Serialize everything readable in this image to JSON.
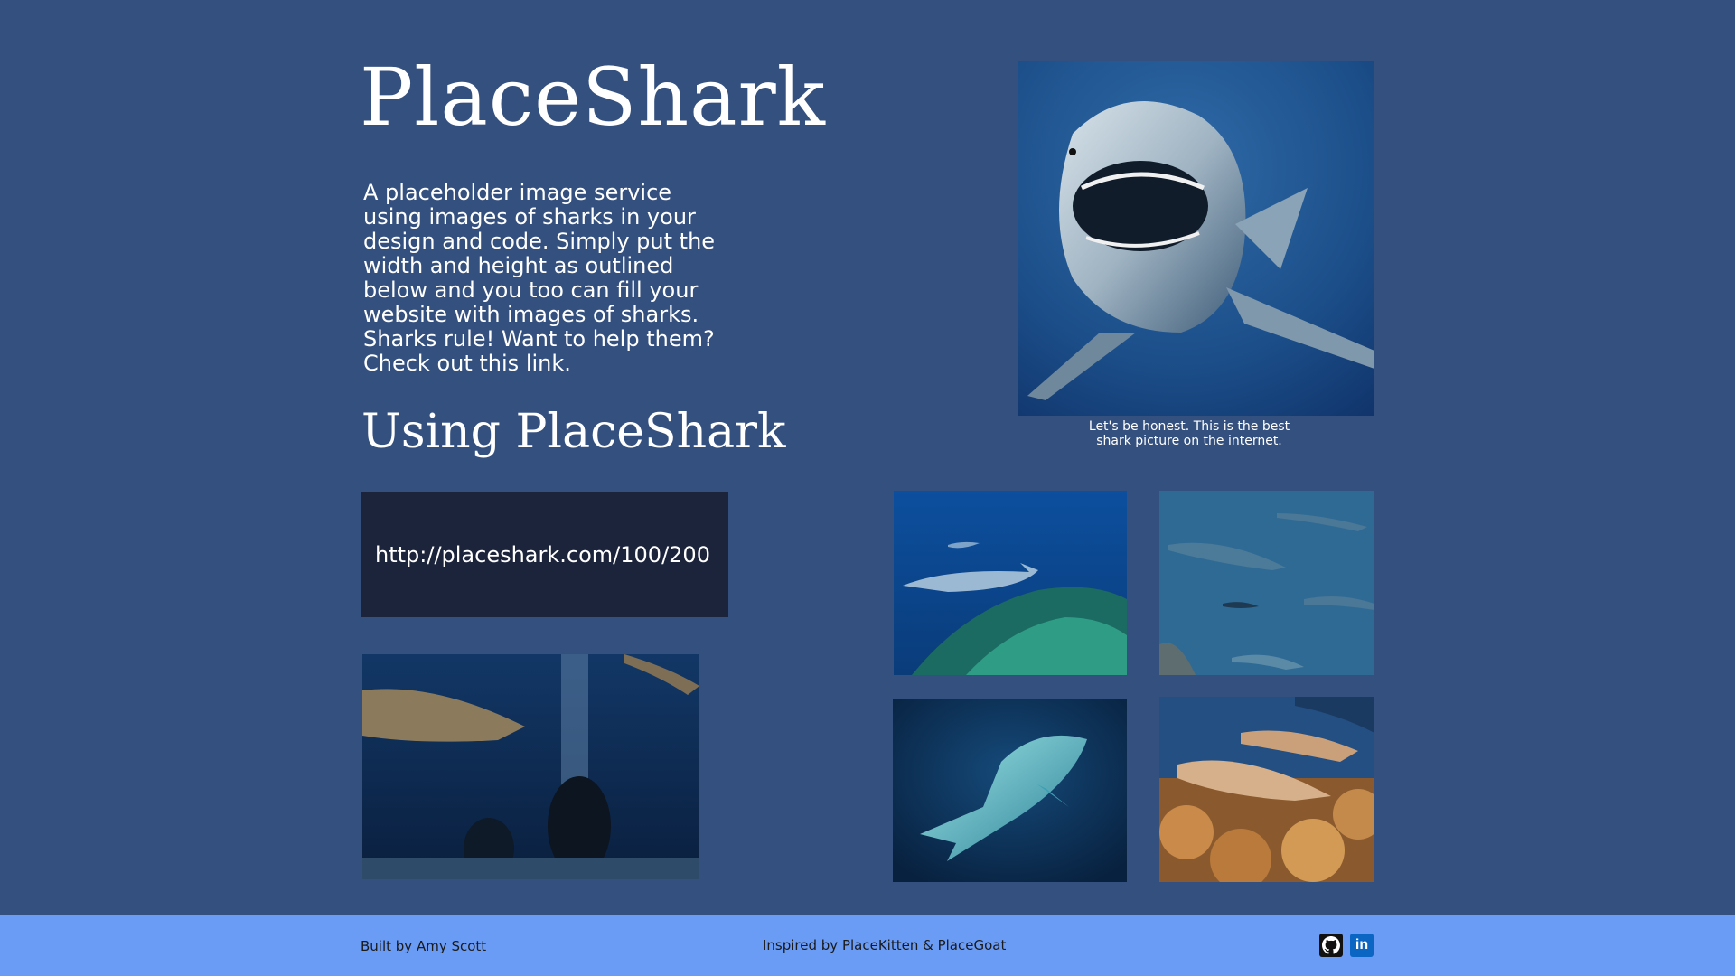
{
  "header": {
    "title": "PlaceShark"
  },
  "intro": {
    "text": "A placeholder image service using images of sharks in your design and code. Simply put the width and height as outlined below and you too can fill your website with images of sharks. Sharks rule! Want to help them? Check out this link."
  },
  "usage": {
    "heading": "Using PlaceShark",
    "example_url": "http://placeshark.com/100/200"
  },
  "hero": {
    "caption": "Let's be honest. This is the best shark picture on the internet."
  },
  "footer": {
    "built_by": "Built by Amy Scott",
    "inspired_by": "Inspired by PlaceKitten & PlaceGoat",
    "linkedin_label": "in"
  },
  "colors": {
    "background": "#34507f",
    "code_box": "#1c243c",
    "footer": "#6a9cf6"
  },
  "icons": [
    "github-icon",
    "linkedin-icon"
  ]
}
